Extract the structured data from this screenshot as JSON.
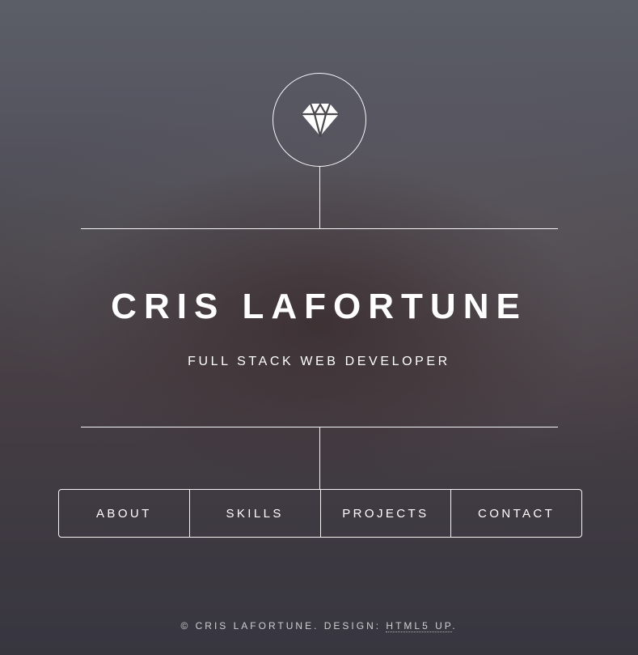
{
  "header": {
    "logo_icon": "diamond-icon",
    "name": "CRIS LAFORTUNE",
    "tagline": "FULL STACK WEB DEVELOPER"
  },
  "nav": {
    "items": [
      {
        "label": "ABOUT"
      },
      {
        "label": "SKILLS"
      },
      {
        "label": "PROJECTS"
      },
      {
        "label": "CONTACT"
      }
    ]
  },
  "footer": {
    "copyright": "© CRIS LAFORTUNE. DESIGN: ",
    "design_link": "HTML5 UP",
    "end": "."
  },
  "colors": {
    "text": "#ffffff",
    "background_top": "#5b5e67",
    "background_bottom": "#37363f"
  }
}
